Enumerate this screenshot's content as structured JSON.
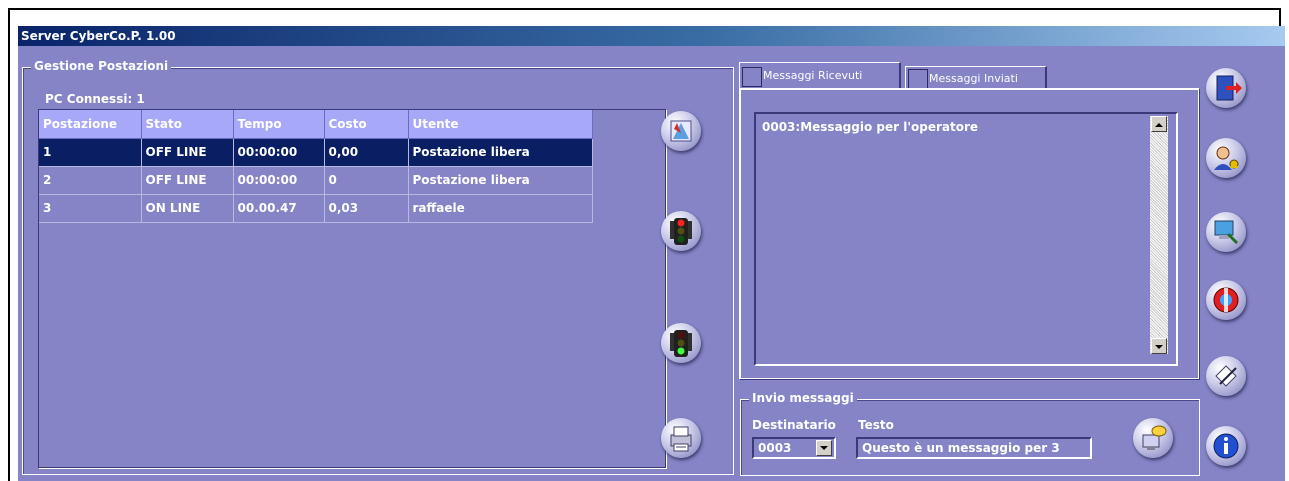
{
  "window": {
    "title": "Server CyberCo.P. 1.00"
  },
  "gestione": {
    "title": "Gestione Postazioni",
    "connected_label": "PC Connessi: 1",
    "columns": [
      "Postazione",
      "Stato",
      "Tempo",
      "Costo",
      "Utente"
    ],
    "rows": [
      [
        "1",
        "OFF LINE",
        "00:00:00",
        "0,00",
        "Postazione libera"
      ],
      [
        "2",
        "OFF LINE",
        "00:00:00",
        "0",
        "Postazione libera"
      ],
      [
        "3",
        "ON LINE",
        "00.00.47",
        "0,03",
        "raffaele"
      ]
    ],
    "selected_row": 0
  },
  "messages": {
    "tabs": [
      "Messaggi Ricevuti",
      "Messaggi Inviati"
    ],
    "active_tab": 0,
    "received_text": "0003:Messaggio per l'operatore"
  },
  "invio": {
    "title": "Invio messaggi",
    "dest_label": "Destinatario",
    "text_label": "Testo",
    "dest_value": "0003",
    "text_value": "Questo è un messaggio per 3"
  },
  "icons": {
    "left": [
      "map-icon",
      "red-traffic-light-icon",
      "green-traffic-light-icon",
      "printer-icon"
    ],
    "right": [
      "exit-door-icon",
      "user-key-icon",
      "computer-search-icon",
      "help-lifebuoy-icon",
      "edit-pen-icon",
      "info-icon"
    ],
    "send": "send-message-icon"
  }
}
